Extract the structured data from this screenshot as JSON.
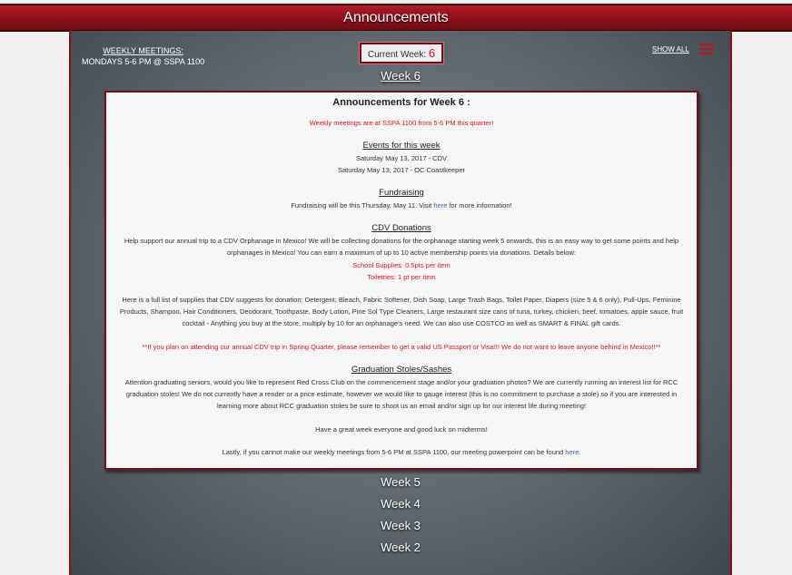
{
  "header": {
    "title": "Announcements"
  },
  "meetings": {
    "label": "WEEKLY MEETINGS:",
    "time": "MONDAYS 5-6 PM @ SSPA 1100"
  },
  "current_week": {
    "label": "Current Week: ",
    "value": "6"
  },
  "nav": {
    "show_all": "SHOW ALL"
  },
  "weeks": {
    "active": "Week 6",
    "others": [
      "Week 5",
      "Week 4",
      "Week 3",
      "Week 2"
    ]
  },
  "announcement": {
    "title": "Announcements for Week 6 :",
    "meeting_notice": "Weekly meetings are at SSPA 1100 from 5-6 PM this quarter!",
    "events_heading": "Events for this week",
    "events": [
      "Saturday May 13, 2017 - CDV",
      "Saturday May 13, 2017 - OC Coastkeeper"
    ],
    "fundraising_heading": "Fundraising",
    "fundraising_pre": "Fundraising will be this Thursday, May 11. Visit ",
    "fundraising_link": "here",
    "fundraising_post": " for more information!",
    "cdv_heading": "CDV Donations",
    "cdv_text": "Help support our annual trip to a CDV Orphanage in Mexico! We will be collecting donations for the orphanage starting week 5 onwards, this is an easy way to get some points and help orphanages in Mexico! You can earn a maximum of up to 10 active membership points via donations. Details below:",
    "cdv_school": "School Supplies: 0.5pts per item",
    "cdv_toiletries": "Toiletries: 1 pt per item",
    "supplies_text": "Here is a full list of supplies that CDV suggests for donation: Detergent, Bleach, Fabric Softener, Dish Soap, Large Trash Bags, Toilet Paper, Diapers (size 5 & 6 only), Pull-Ups, Feminine Products, Shampoo, Hair Conditioners, Deodorant, Toothpaste, Body Lotion, Pine Sol Type Cleaners, Large restaurant size cans of tuna, turkey, chicken, beef, tomatoes, apple sauce, fruit cocktail - Anything you buy at the store, multiply by 10 for an orphanage's need. We can also use COSTCO as well as SMART & FINAL gift cards.",
    "passport_notice": "**If you plan on attending our annual CDV trip in Spring Quarter, please remember to get a valid US Passport or Visa!!! We do not want to leave anyone behind in Mexico!!**",
    "stoles_heading": "Graduation Stoles/Sashes",
    "stoles_text": "Attention graduating seniors, would you like to represent Red Cross Club on the commencement stage and/or your graduation photos? We are currently running an interest list for RCC graduation stoles! We do not currently have a render or a price estimate, however we would like to gauge interest (this is no commitment to purchase a stole) so if you are interested in learning more about RCC graduation stoles be sure to shoot us an email and/or sign up for our interest life during meeting!",
    "closing": "Have a great week everyone and good luck on midterms!",
    "last_pre": "Lastly, if you cannot make our weekly meetings from 5-6 PM at SSPA 1100, our meeting powerpoint can be found ",
    "last_link": "here."
  }
}
